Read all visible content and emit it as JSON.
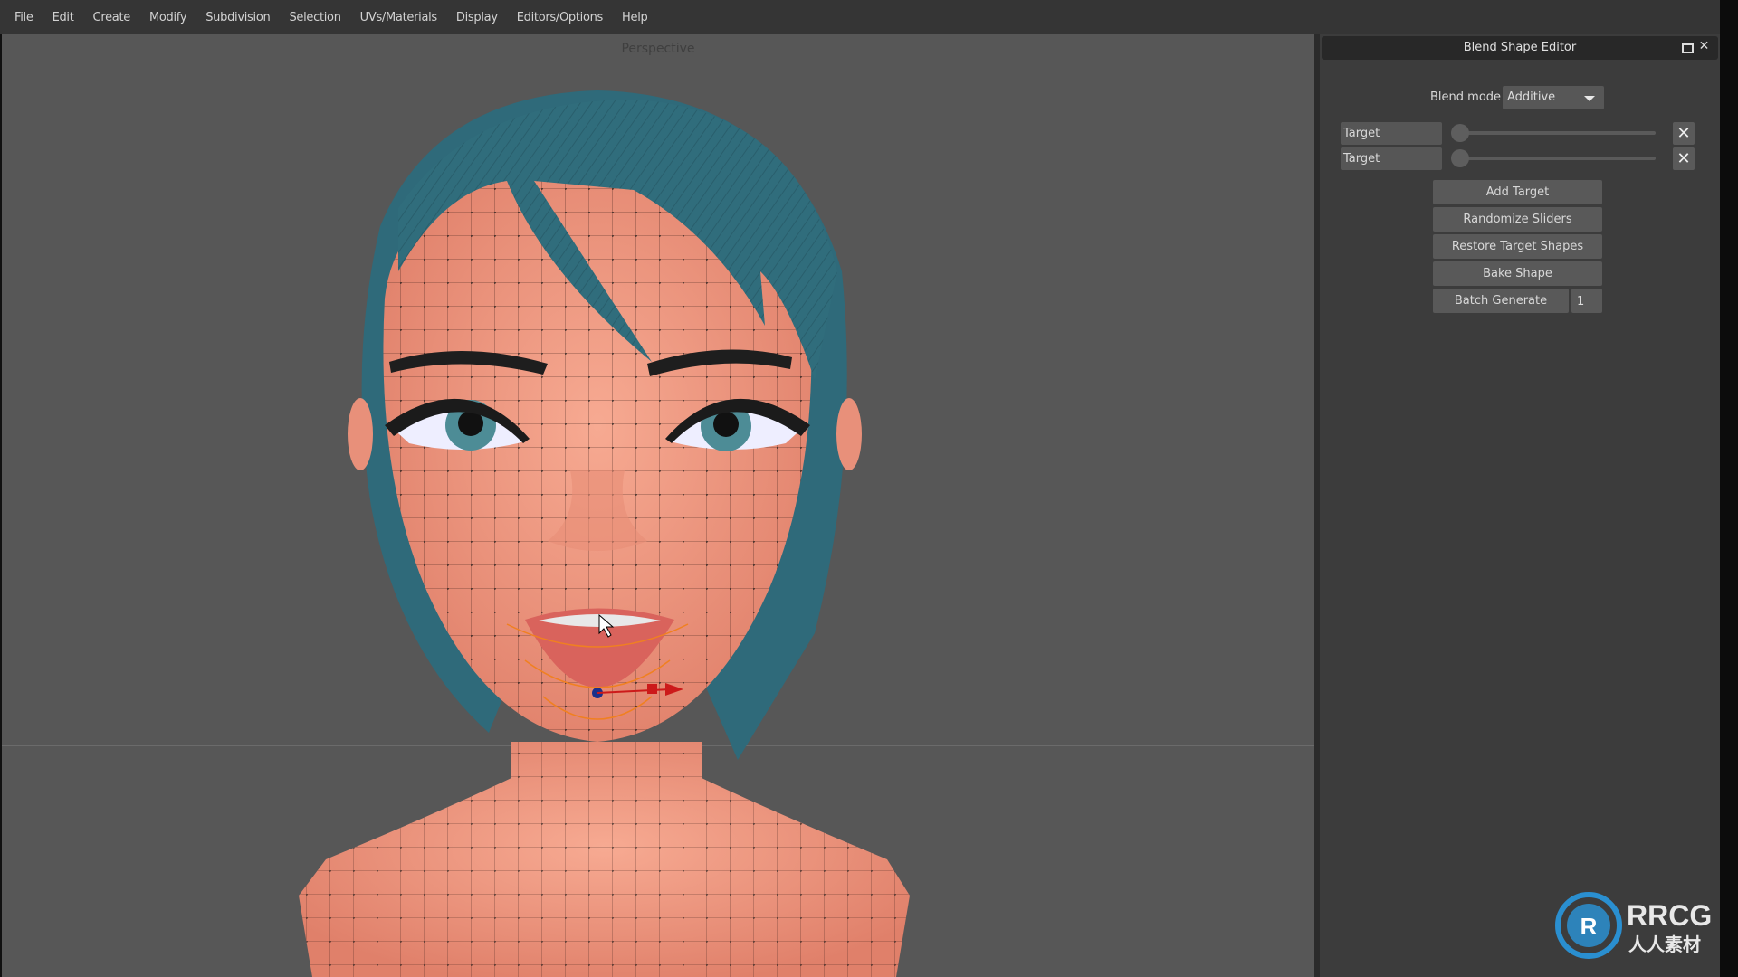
{
  "menu": [
    "File",
    "Edit",
    "Create",
    "Modify",
    "Subdivision",
    "Selection",
    "UVs/Materials",
    "Display",
    "Editors/Options",
    "Help"
  ],
  "viewport": {
    "title": "Perspective"
  },
  "panel": {
    "title": "Blend Shape Editor",
    "blend_mode_label": "Blend mode",
    "blend_mode_value": "Additive",
    "targets": [
      {
        "name": "Target",
        "weight": 0
      },
      {
        "name": "Target",
        "weight": 0
      }
    ],
    "buttons": {
      "add_target": "Add Target",
      "randomize": "Randomize Sliders",
      "restore": "Restore Target Shapes",
      "bake": "Bake Shape",
      "batch": "Batch Generate",
      "batch_count": "1"
    }
  },
  "watermark": {
    "logo_text": "RRCG",
    "sub_text": "人人素材"
  },
  "colors": {
    "skin": "#f09a82",
    "hair": "#2f6a7a",
    "viewport_bg": "#575757",
    "panel_bg": "#3c3c3c"
  }
}
